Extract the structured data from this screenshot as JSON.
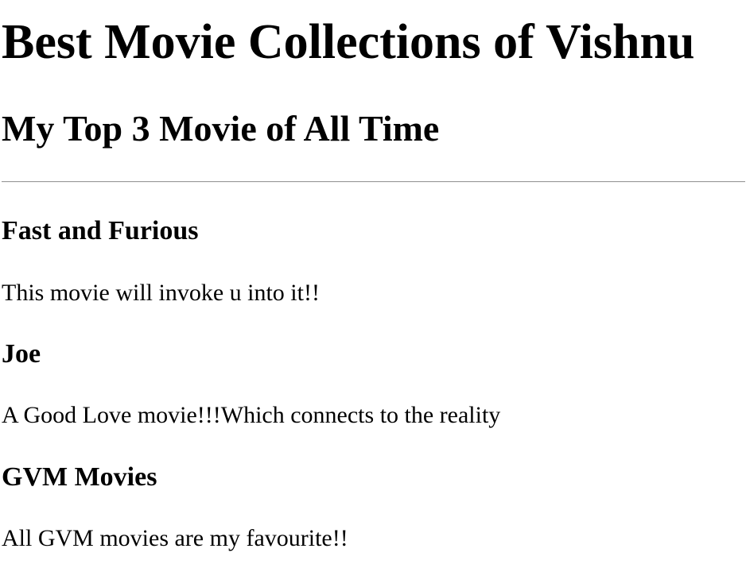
{
  "header": {
    "title": "Best Movie Collections of Vishnu",
    "subtitle": "My Top 3 Movie of All Time"
  },
  "movies": [
    {
      "title": "Fast and Furious",
      "description": "This movie will invoke u into it!!"
    },
    {
      "title": "Joe",
      "description": "A Good Love movie!!!Which connects to the reality"
    },
    {
      "title": "GVM Movies",
      "description": "All GVM movies are my favourite!!"
    }
  ]
}
